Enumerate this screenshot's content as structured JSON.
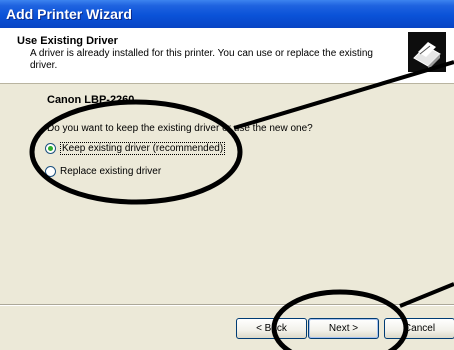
{
  "window": {
    "title": "Add Printer Wizard"
  },
  "header": {
    "title": "Use Existing Driver",
    "description": "A driver is already installed for this printer. You can use or replace the existing driver."
  },
  "content": {
    "printer_name": "Canon LBP-2260",
    "question": "Do you want to keep the existing driver or use the new one?",
    "options": [
      {
        "label": "Keep existing driver (recommended)",
        "checked": true
      },
      {
        "label": "Replace existing driver",
        "checked": false
      }
    ]
  },
  "buttons": {
    "back_label": "< Back",
    "next_label": "Next >",
    "cancel_label": "Cancel"
  }
}
